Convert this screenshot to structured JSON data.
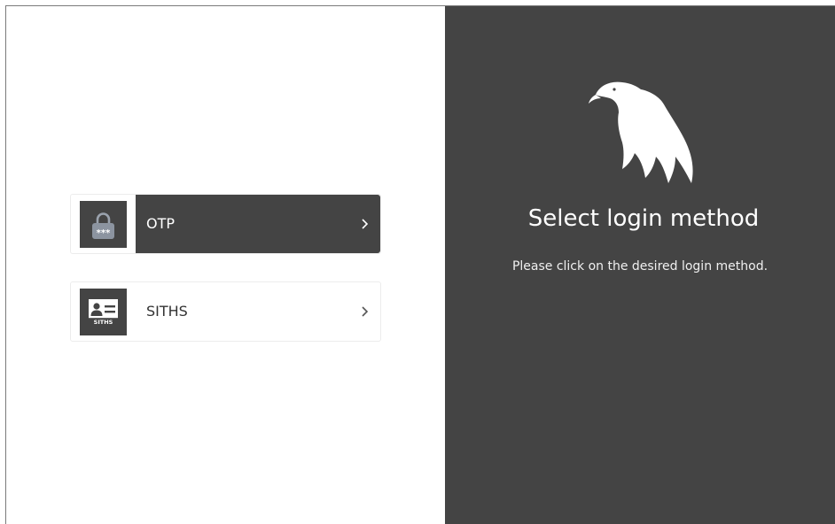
{
  "methods": [
    {
      "id": "otp",
      "label": "OTP",
      "icon": "lock-icon",
      "icon_text": "***",
      "selected": true
    },
    {
      "id": "siths",
      "label": "SITHS",
      "icon": "id-card-icon",
      "icon_text": "SITHS",
      "selected": false
    }
  ],
  "info": {
    "logo": "eagle-logo-icon",
    "title": "Select login method",
    "subtitle": "Please click on the desired login method."
  },
  "colors": {
    "dark_panel": "#444444",
    "background": "#ffffff",
    "text_dark": "#333333",
    "text_light": "#ffffff"
  }
}
